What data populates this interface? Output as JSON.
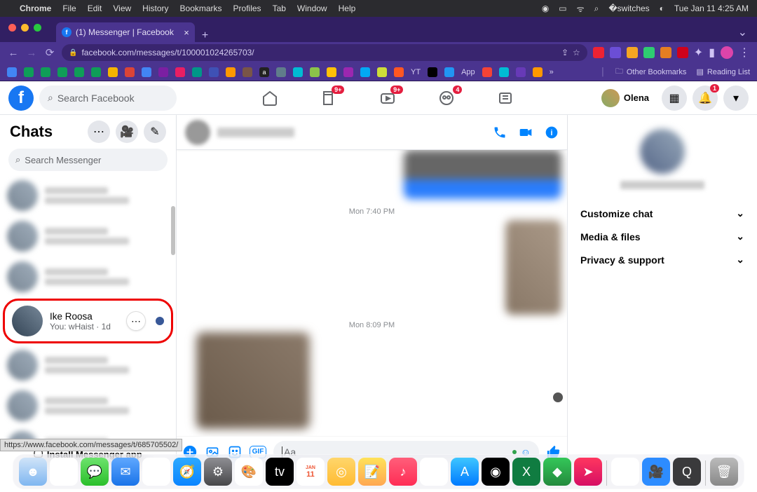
{
  "menubar": {
    "app": "Chrome",
    "items": [
      "File",
      "Edit",
      "View",
      "History",
      "Bookmarks",
      "Profiles",
      "Tab",
      "Window",
      "Help"
    ],
    "clock": "Tue Jan 11  4:25 AM"
  },
  "browser": {
    "tab_title": "(1) Messenger | Facebook",
    "url_display": "facebook.com/messages/t/100001024265703/",
    "other_bookmarks": "Other Bookmarks",
    "reading_list": "Reading List",
    "bk_yt": "YT",
    "bk_app": "App"
  },
  "fb": {
    "search_placeholder": "Search Facebook",
    "profile_name": "Olena",
    "badge9": "9+",
    "badge4": "4",
    "badge1": "1"
  },
  "chats": {
    "title": "Chats",
    "search_placeholder": "Search Messenger",
    "highlighted": {
      "name": "Ike Roosa",
      "sub": "You: wHaist · 1d"
    },
    "install_label": "Install Messenger app"
  },
  "conv": {
    "ts1": "Mon 7:40 PM",
    "ts2": "Mon 8:09 PM",
    "input_placeholder": "Aa"
  },
  "info": {
    "row1": "Customize chat",
    "row2": "Media & files",
    "row3": "Privacy & support"
  },
  "tooltip": "https://www.facebook.com/messages/t/685705502/"
}
